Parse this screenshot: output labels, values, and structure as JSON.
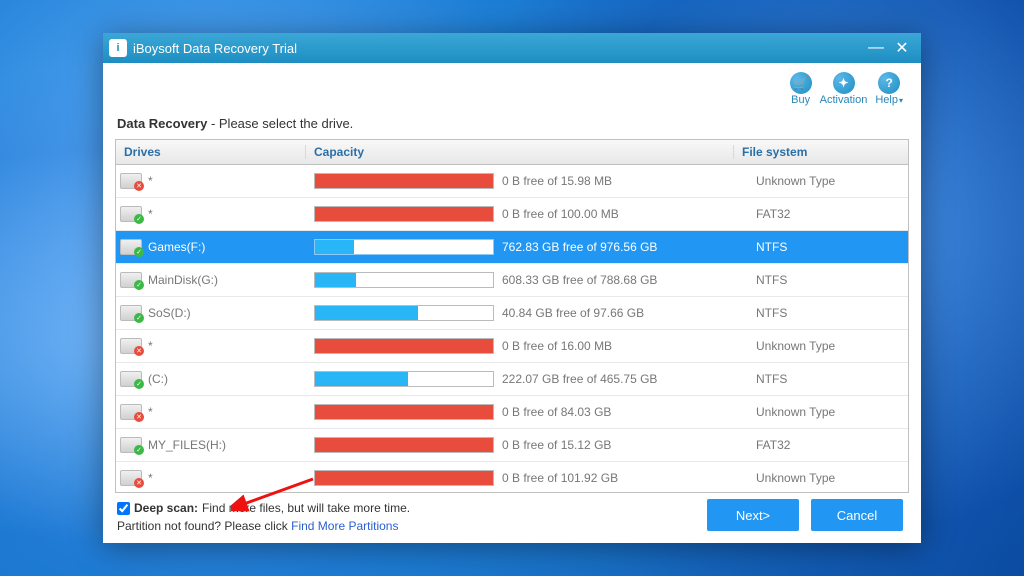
{
  "titlebar": {
    "title": "iBoysoft Data Recovery Trial",
    "icon_glyph": "i"
  },
  "top_actions": {
    "buy": {
      "label": "Buy",
      "glyph": "🛒"
    },
    "activation": {
      "label": "Activation",
      "glyph": "✦"
    },
    "help": {
      "label": "Help",
      "glyph": "?"
    }
  },
  "header": {
    "title": "Data Recovery",
    "subtitle": " - Please select the drive."
  },
  "columns": {
    "drives": "Drives",
    "capacity": "Capacity",
    "filesystem": "File system"
  },
  "drives": [
    {
      "name": "*",
      "status": "bad",
      "fill_color": "red",
      "fill_pct": 100,
      "capacity_text": "0 B free of 15.98 MB",
      "fs": "Unknown Type",
      "selected": false
    },
    {
      "name": "*",
      "status": "ok",
      "fill_color": "red",
      "fill_pct": 100,
      "capacity_text": "0 B free of 100.00 MB",
      "fs": "FAT32",
      "selected": false
    },
    {
      "name": "Games(F:)",
      "status": "ok",
      "fill_color": "blue",
      "fill_pct": 22,
      "capacity_text": "762.83 GB free of 976.56 GB",
      "fs": "NTFS",
      "selected": true
    },
    {
      "name": "MainDisk(G:)",
      "status": "ok",
      "fill_color": "blue",
      "fill_pct": 23,
      "capacity_text": "608.33 GB free of 788.68 GB",
      "fs": "NTFS",
      "selected": false
    },
    {
      "name": "SoS(D:)",
      "status": "ok",
      "fill_color": "blue",
      "fill_pct": 58,
      "capacity_text": "40.84 GB free of 97.66 GB",
      "fs": "NTFS",
      "selected": false
    },
    {
      "name": "*",
      "status": "bad",
      "fill_color": "red",
      "fill_pct": 100,
      "capacity_text": "0 B free of 16.00 MB",
      "fs": "Unknown Type",
      "selected": false
    },
    {
      "name": "(C:)",
      "status": "ok",
      "fill_color": "blue",
      "fill_pct": 52,
      "capacity_text": "222.07 GB free of 465.75 GB",
      "fs": "NTFS",
      "selected": false
    },
    {
      "name": "*",
      "status": "bad",
      "fill_color": "red",
      "fill_pct": 100,
      "capacity_text": "0 B free of 84.03 GB",
      "fs": "Unknown Type",
      "selected": false
    },
    {
      "name": "MY_FILES(H:)",
      "status": "ok",
      "fill_color": "red",
      "fill_pct": 100,
      "capacity_text": "0 B free of 15.12 GB",
      "fs": "FAT32",
      "selected": false
    },
    {
      "name": "*",
      "status": "bad",
      "fill_color": "red",
      "fill_pct": 100,
      "capacity_text": "0 B free of 101.92 GB",
      "fs": "Unknown Type",
      "selected": false
    }
  ],
  "deep_scan": {
    "checked": true,
    "label": "Deep scan:",
    "desc": " Find more files, but will take more time."
  },
  "partition_line": {
    "prefix": "Partition not found? Please click ",
    "link": "Find More Partitions"
  },
  "buttons": {
    "next": "Next>",
    "cancel": "Cancel"
  }
}
